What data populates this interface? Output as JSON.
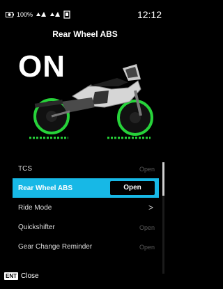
{
  "status": {
    "battery": "100%",
    "time": "12:12"
  },
  "header": {
    "title": "Rear Wheel ABS"
  },
  "hero": {
    "state_text": "ON"
  },
  "menu": {
    "items": [
      {
        "label": "TCS",
        "value": "Open",
        "selected": false
      },
      {
        "label": "Rear Wheel ABS",
        "value": "Open",
        "selected": true
      },
      {
        "label": "Ride Mode",
        "value": "",
        "selected": false,
        "chevron": ">"
      },
      {
        "label": "Quickshifter",
        "value": "Open",
        "selected": false
      },
      {
        "label": "Gear Change Reminder",
        "value": "Open",
        "selected": false
      }
    ]
  },
  "footer": {
    "key": "ENT",
    "label": "Close"
  },
  "colors": {
    "accent": "#17b8e6",
    "wheel_highlight": "#27d33a",
    "background": "#000000"
  }
}
